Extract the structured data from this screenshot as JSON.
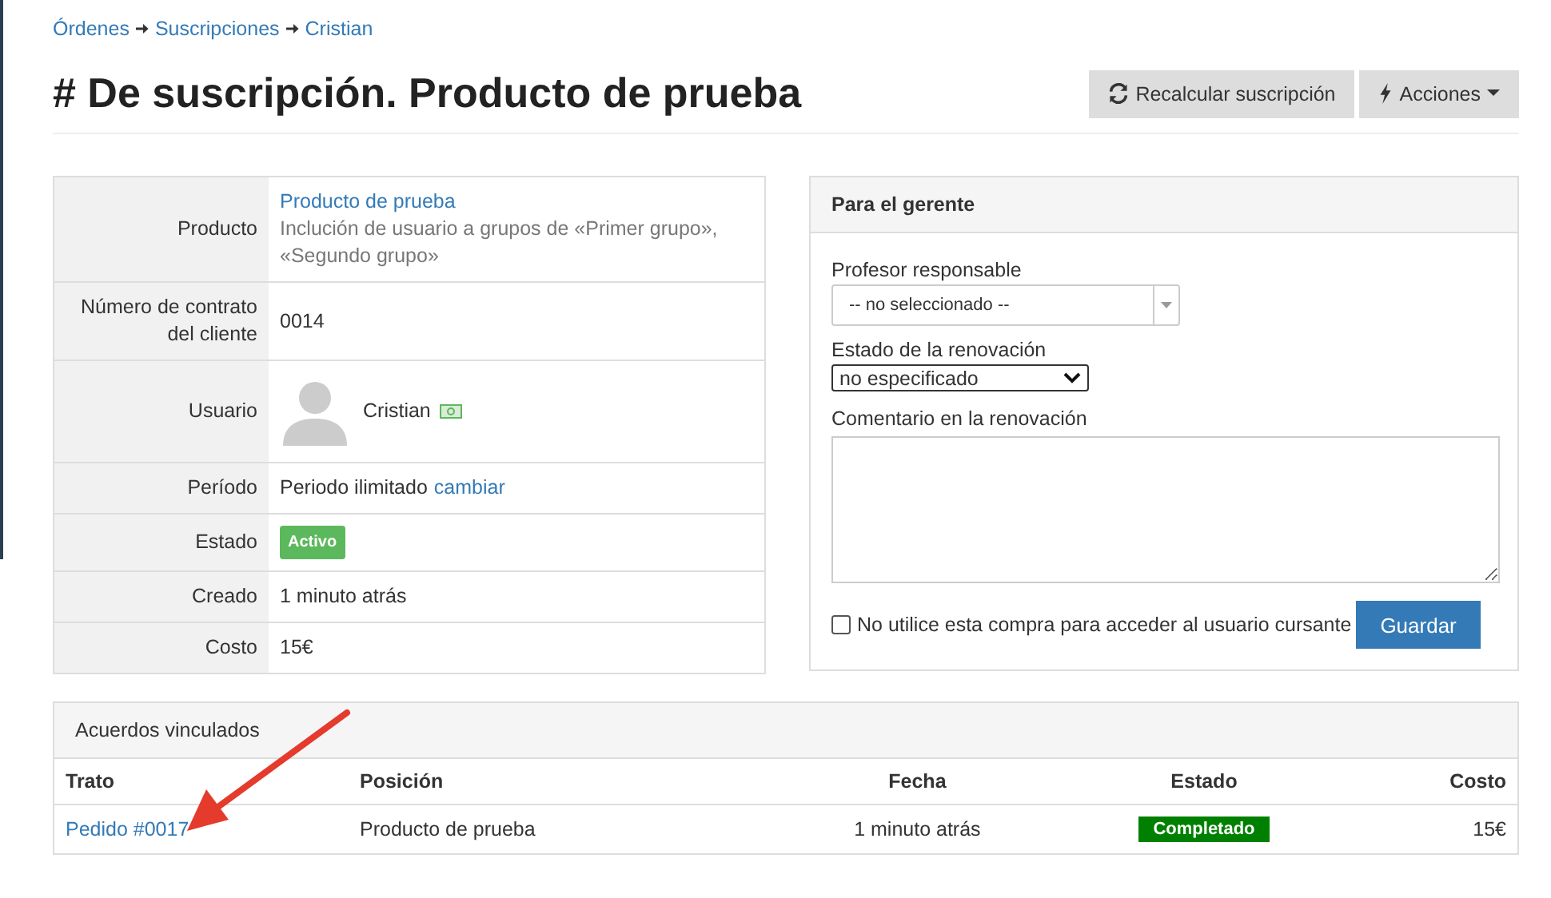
{
  "breadcrumb": [
    "Órdenes",
    "Suscripciones",
    "Cristian"
  ],
  "title": "# De suscripción. Producto de prueba",
  "header_buttons": [
    {
      "kind": "refresh",
      "label": "Recalcular suscripción"
    },
    {
      "kind": "actions",
      "label": "Acciones"
    }
  ],
  "details": [
    {
      "kind": "product",
      "label": "Producto",
      "link": "Producto de prueba",
      "text": "Inclución de usuario a grupos de «Primer grupo», «Segundo grupo»"
    },
    {
      "kind": "text",
      "label": "Número de contrato del cliente",
      "text": "0014"
    },
    {
      "kind": "user",
      "label": "Usuario",
      "text": "Cristian"
    },
    {
      "kind": "period",
      "label": "Período",
      "text": "Periodo ilimitado",
      "link": "cambiar"
    },
    {
      "kind": "badge",
      "label": "Estado",
      "text": "Activo"
    },
    {
      "kind": "text",
      "label": "Creado",
      "text": "1 minuto atrás"
    },
    {
      "kind": "text",
      "label": "Costo",
      "text": "15€"
    }
  ],
  "manager_panel": {
    "title": "Para el gerente",
    "teacher": {
      "label": "Profesor responsable",
      "value": "-- no seleccionado --"
    },
    "renewal_status": {
      "label": "Estado de la renovación",
      "value": "no especificado"
    },
    "renewal_comment": {
      "label": "Comentario en la renovación"
    },
    "no_access": {
      "label": "No utilice esta compra para acceder al usuario cursante",
      "checked": false
    },
    "save_button": "Guardar"
  },
  "linked_deals": {
    "title": "Acuerdos vinculados",
    "columns": [
      "Trato",
      "Posición",
      "Fecha",
      "Estado",
      "Costo"
    ],
    "rows": [
      {
        "deal": "Pedido #0017",
        "position": "Producto de prueba",
        "date": "1 minuto atrás",
        "status": "Completado",
        "cost": "15€"
      }
    ]
  }
}
